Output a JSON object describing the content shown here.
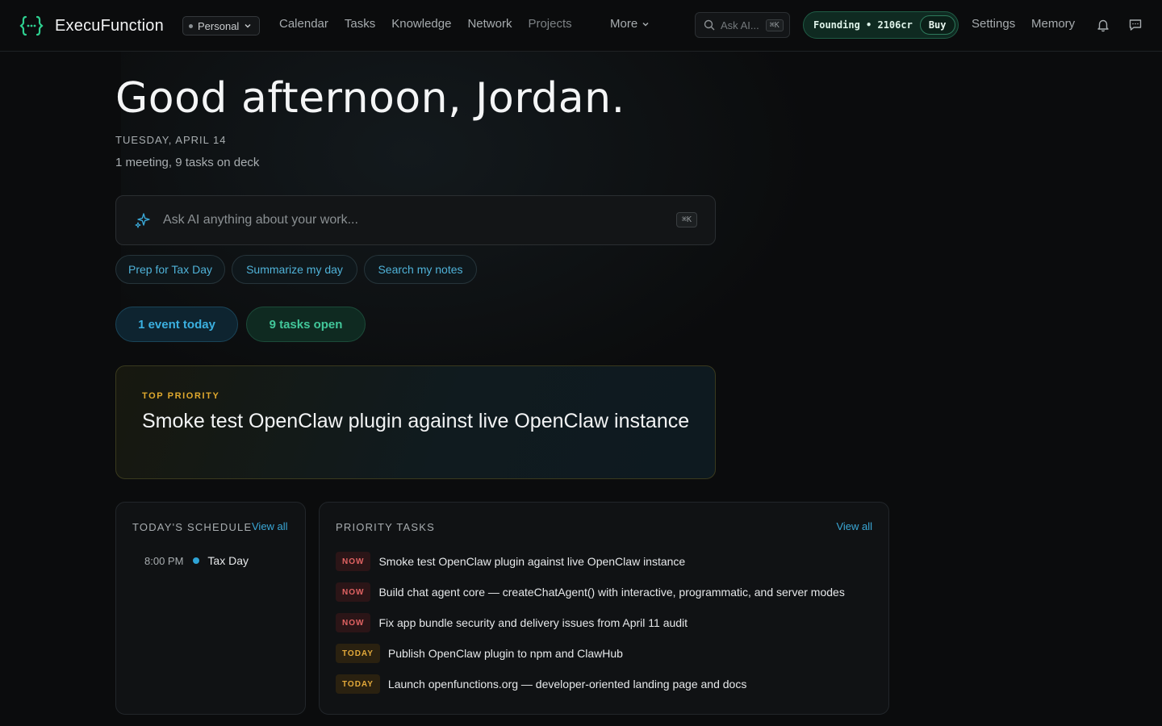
{
  "header": {
    "app_name": "ExecuFunction",
    "workspace": "Personal",
    "nav": [
      "Calendar",
      "Tasks",
      "Knowledge",
      "Network",
      "Projects"
    ],
    "more_label": "More",
    "search_placeholder": "Ask AI...",
    "search_shortcut": "⌘K",
    "credits_label": "Founding • 2106cr",
    "buy_label": "Buy",
    "settings_label": "Settings",
    "memory_label": "Memory"
  },
  "main": {
    "greeting": "Good afternoon, Jordan.",
    "date": "TUESDAY, APRIL 14",
    "summary": "1 meeting, 9 tasks on deck",
    "ask_placeholder": "Ask AI anything about your work...",
    "ask_shortcut": "⌘K",
    "chips": [
      "Prep for Tax Day",
      "Summarize my day",
      "Search my notes"
    ],
    "stats": {
      "events": "1 event today",
      "tasks": "9 tasks open"
    },
    "top_priority": {
      "label": "TOP PRIORITY",
      "title": "Smoke test OpenClaw plugin against live OpenClaw instance"
    }
  },
  "schedule": {
    "heading": "TODAY'S SCHEDULE",
    "view_all": "View all",
    "items": [
      {
        "time": "8:00 PM",
        "name": "Tax Day"
      }
    ]
  },
  "priority_tasks": {
    "heading": "PRIORITY TASKS",
    "view_all": "View all",
    "items": [
      {
        "badge": "NOW",
        "title": "Smoke test OpenClaw plugin against live OpenClaw instance"
      },
      {
        "badge": "NOW",
        "title": "Build chat agent core — createChatAgent() with interactive, programmatic, and server modes"
      },
      {
        "badge": "NOW",
        "title": "Fix app bundle security and delivery issues from April 11 audit"
      },
      {
        "badge": "TODAY",
        "title": "Publish OpenClaw plugin to npm and ClawHub"
      },
      {
        "badge": "TODAY",
        "title": "Launch openfunctions.org — developer-oriented landing page and docs"
      }
    ]
  },
  "colors": {
    "accent_blue": "#3aa7d6",
    "accent_green": "#42c79a",
    "priority_amber": "#e0a92e",
    "now_red": "#e26363"
  },
  "icons": [
    "logo-braces-icon",
    "chevron-down-icon",
    "search-icon",
    "sparkle-icon",
    "bell-icon",
    "chat-icon"
  ]
}
